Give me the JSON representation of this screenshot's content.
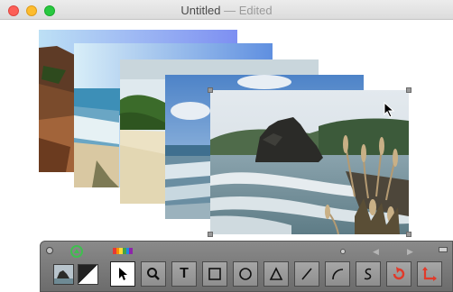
{
  "window": {
    "title": "Untitled",
    "separator": "—",
    "status": "Edited"
  },
  "canvas": {
    "photos": [
      {
        "name": "coast-cliff-photo"
      },
      {
        "name": "beach-waves-photo"
      },
      {
        "name": "sandy-beach-photo"
      },
      {
        "name": "ocean-surf-photo"
      },
      {
        "name": "lion-rock-beach-photo",
        "selected": true
      }
    ]
  },
  "palette": {
    "tools": [
      {
        "name": "select-arrow-tool",
        "icon": "arrow-icon",
        "selected": true
      },
      {
        "name": "zoom-tool",
        "icon": "magnifier-icon"
      },
      {
        "name": "text-tool",
        "icon": "text-icon",
        "glyph": "T"
      },
      {
        "name": "rectangle-tool",
        "icon": "square-icon"
      },
      {
        "name": "oval-tool",
        "icon": "circle-icon"
      },
      {
        "name": "triangle-tool",
        "icon": "triangle-icon"
      },
      {
        "name": "line-tool",
        "icon": "line-icon"
      },
      {
        "name": "arc-tool",
        "icon": "arc-icon"
      },
      {
        "name": "freehand-tool",
        "icon": "squiggle-icon"
      },
      {
        "name": "rotate-tool",
        "icon": "rotate-icon"
      },
      {
        "name": "crop-tool",
        "icon": "crop-icon"
      }
    ],
    "spectrum_colors": [
      "#e53935",
      "#fb8c00",
      "#fdd835",
      "#43a047",
      "#1e88e5",
      "#8e24aa"
    ],
    "accent_green": "#3fbf4f",
    "accent_red": "#e03a2a"
  }
}
